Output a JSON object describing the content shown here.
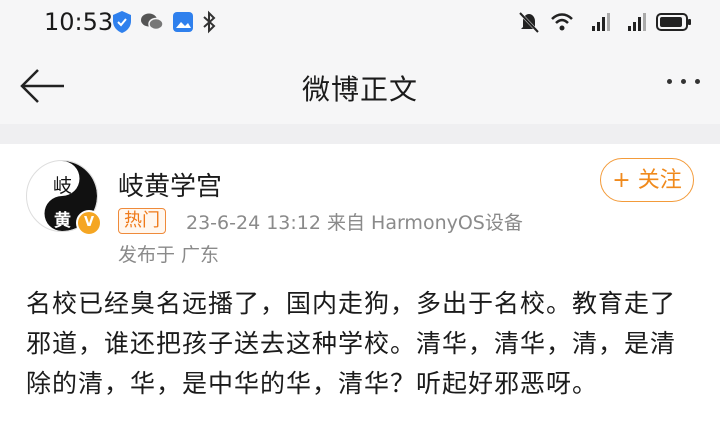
{
  "status_bar": {
    "time": "10:53",
    "left_icons": [
      "shield-icon",
      "wechat-icon",
      "photo-icon",
      "bluetooth-icon"
    ],
    "right_icons": [
      "mute-icon",
      "wifi-icon",
      "signal-icon",
      "signal-icon",
      "battery-icon"
    ]
  },
  "nav": {
    "title": "微博正文"
  },
  "post": {
    "username": "岐黄学宫",
    "avatar_chars": [
      "岐",
      "黄"
    ],
    "hot_tag": "热门",
    "meta": "23-6-24 13:12  来自 HarmonyOS设备",
    "location": "发布于 广东",
    "follow_label": "+ 关注",
    "content": "名校已经臭名远播了，国内走狗，多出于名校。教育走了邪道，谁还把孩子送去这种学校。清华，清华，清，是清除的清，华，是中华的华，清华？听起好邪恶呀。"
  },
  "colors": {
    "accent": "#f08a1c",
    "meta_gray": "#8a8a8a",
    "bar_bg": "#f6f6f7"
  }
}
